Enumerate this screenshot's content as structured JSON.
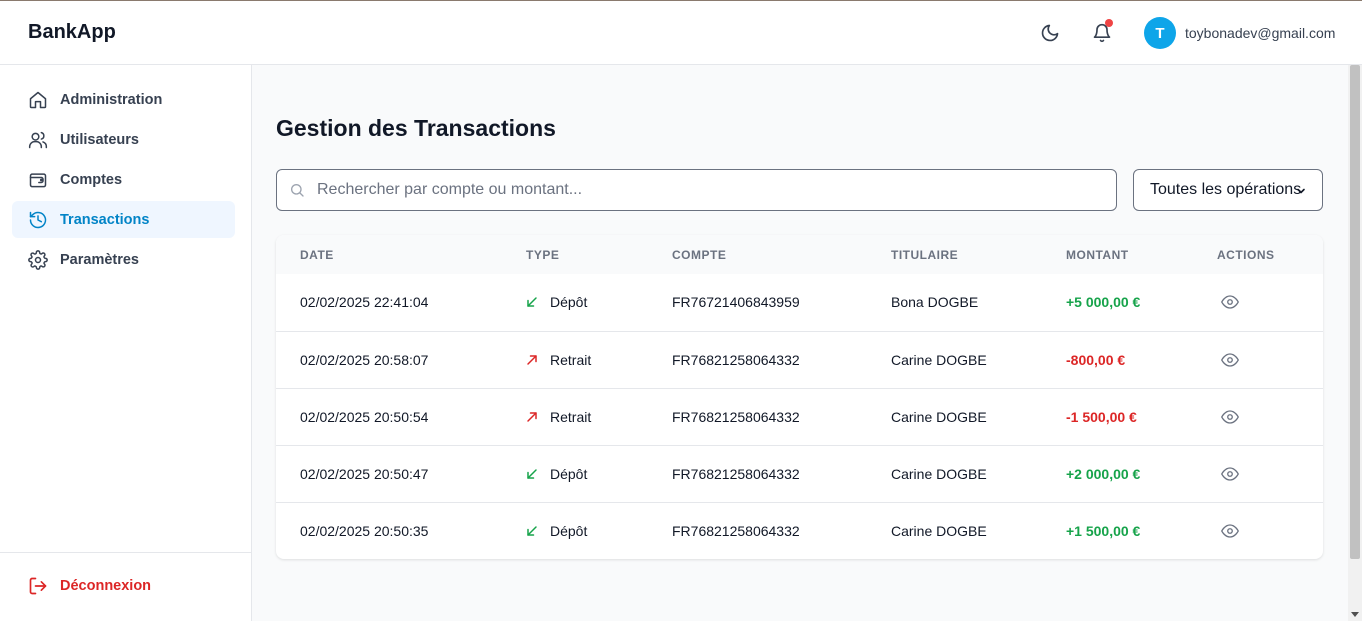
{
  "app": {
    "brand": "BankApp"
  },
  "header": {
    "theme_icon": "moon-icon",
    "notification_icon": "bell-icon",
    "user": {
      "initial": "T",
      "email": "toybonadev@gmail.com"
    }
  },
  "sidebar": {
    "items": [
      {
        "label": "Administration",
        "icon": "home-icon",
        "active": false
      },
      {
        "label": "Utilisateurs",
        "icon": "users-icon",
        "active": false
      },
      {
        "label": "Comptes",
        "icon": "wallet-icon",
        "active": false
      },
      {
        "label": "Transactions",
        "icon": "history-icon",
        "active": true
      },
      {
        "label": "Paramètres",
        "icon": "gear-icon",
        "active": false
      }
    ],
    "logout": {
      "label": "Déconnexion",
      "icon": "logout-icon"
    }
  },
  "main": {
    "title": "Gestion des Transactions",
    "search": {
      "placeholder": "Rechercher par compte ou montant...",
      "value": ""
    },
    "filter": {
      "selected": "Toutes les opérations"
    },
    "table": {
      "headers": [
        "DATE",
        "TYPE",
        "COMPTE",
        "TITULAIRE",
        "MONTANT",
        "ACTIONS"
      ],
      "rows": [
        {
          "date": "02/02/2025 22:41:04",
          "type": "Dépôt",
          "direction": "in",
          "account": "FR76721406843959",
          "holder": "Bona DOGBE",
          "amount": "+5 000,00 €"
        },
        {
          "date": "02/02/2025 20:58:07",
          "type": "Retrait",
          "direction": "out",
          "account": "FR76821258064332",
          "holder": "Carine DOGBE",
          "amount": "-800,00 €"
        },
        {
          "date": "02/02/2025 20:50:54",
          "type": "Retrait",
          "direction": "out",
          "account": "FR76821258064332",
          "holder": "Carine DOGBE",
          "amount": "-1 500,00 €"
        },
        {
          "date": "02/02/2025 20:50:47",
          "type": "Dépôt",
          "direction": "in",
          "account": "FR76821258064332",
          "holder": "Carine DOGBE",
          "amount": "+2 000,00 €"
        },
        {
          "date": "02/02/2025 20:50:35",
          "type": "Dépôt",
          "direction": "in",
          "account": "FR76821258064332",
          "holder": "Carine DOGBE",
          "amount": "+1 500,00 €"
        }
      ]
    }
  },
  "colors": {
    "accent": "#0284c7",
    "avatar": "#0ea5e9",
    "positive": "#16a34a",
    "negative": "#dc2626",
    "notification_dot": "#ef4444"
  }
}
